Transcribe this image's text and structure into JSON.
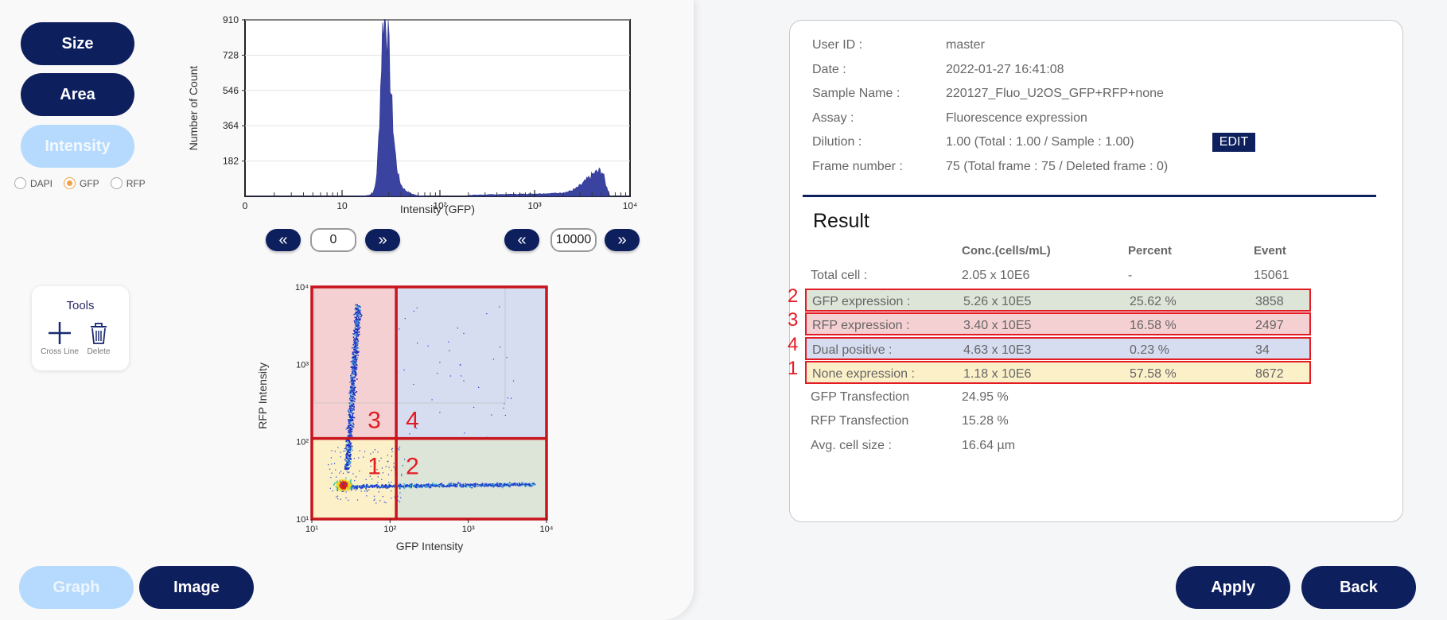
{
  "left": {
    "buttons": {
      "size": "Size",
      "area": "Area",
      "intensity": "Intensity"
    },
    "radios": [
      {
        "label": "DAPI",
        "selected": false
      },
      {
        "label": "GFP",
        "selected": true
      },
      {
        "label": "RFP",
        "selected": false
      }
    ],
    "range": {
      "min_value": "0",
      "max_value": "10000"
    },
    "tools": {
      "title": "Tools",
      "cross_line": "Cross Line",
      "delete": "Delete"
    },
    "bottom": {
      "graph": "Graph",
      "image": "Image"
    }
  },
  "histogram": {
    "type": "area",
    "xlabel": "Intensity (GFP)",
    "ylabel": "Number of Count",
    "x_scale": "log",
    "x_ticks": [
      "0",
      "10",
      "10²",
      "10³",
      "10⁴"
    ],
    "y_ticks": [
      "182",
      "364",
      "546",
      "728",
      "910"
    ],
    "ylim": [
      0,
      910
    ],
    "color": "#3b43a0",
    "peaks": [
      {
        "x": 27,
        "y": 910
      },
      {
        "x": 5000,
        "y": 110
      }
    ]
  },
  "scatter": {
    "type": "scatter",
    "xlabel": "GFP Intensity",
    "ylabel": "RFP Intensity",
    "x_ticks": [
      "10¹",
      "10²",
      "10³",
      "10⁴"
    ],
    "y_ticks": [
      "10¹",
      "10²",
      "10³",
      "10⁴"
    ],
    "x_range": [
      10,
      10000
    ],
    "y_range": [
      10,
      10000
    ],
    "gate_x": 120,
    "gate_y": 110,
    "quadrants": [
      {
        "label": "1",
        "color": "#fbf0c8"
      },
      {
        "label": "2",
        "color": "#dde4d8"
      },
      {
        "label": "3",
        "color": "#f4d0d2"
      },
      {
        "label": "4",
        "color": "#d6ddf0"
      }
    ]
  },
  "info": {
    "rows": [
      {
        "label": "User ID :",
        "value": "master"
      },
      {
        "label": "Date :",
        "value": "2022-01-27 16:41:08"
      },
      {
        "label": "Sample Name :",
        "value": "220127_Fluo_U2OS_GFP+RFP+none"
      },
      {
        "label": "Assay :",
        "value": "Fluorescence expression"
      },
      {
        "label": "Dilution :",
        "value": "1.00 (Total : 1.00 / Sample : 1.00)"
      },
      {
        "label": "Frame number :",
        "value": "75 (Total frame : 75 / Deleted frame : 0)"
      }
    ],
    "edit": "EDIT"
  },
  "result": {
    "title": "Result",
    "headers": [
      "Conc.(cells/mL)",
      "Percent",
      "Event"
    ],
    "rows": [
      {
        "label": "Total cell :",
        "conc": "2.05 x 10E6",
        "percent": "-",
        "event": "15061"
      },
      {
        "label": "GFP expression :",
        "conc": "5.26 x 10E5",
        "percent": "25.62 %",
        "event": "3858",
        "quad": "2",
        "color": "#dde4d8"
      },
      {
        "label": "RFP expression :",
        "conc": "3.40 x 10E5",
        "percent": "16.58 %",
        "event": "2497",
        "quad": "3",
        "color": "#f4d0d2"
      },
      {
        "label": "Dual positive :",
        "conc": "4.63 x 10E3",
        "percent": "0.23 %",
        "event": "34",
        "quad": "4",
        "color": "#d6ddf0"
      },
      {
        "label": "None expression :",
        "conc": "1.18 x 10E6",
        "percent": "57.58 %",
        "event": "8672",
        "quad": "1",
        "color": "#fbf0c8"
      },
      {
        "label": "GFP Transfection",
        "conc": "24.95 %"
      },
      {
        "label": "RFP Transfection",
        "conc": "15.28 %"
      },
      {
        "label": "Avg. cell size :",
        "conc": "16.64 µm"
      }
    ]
  },
  "actions": {
    "apply": "Apply",
    "back": "Back"
  }
}
